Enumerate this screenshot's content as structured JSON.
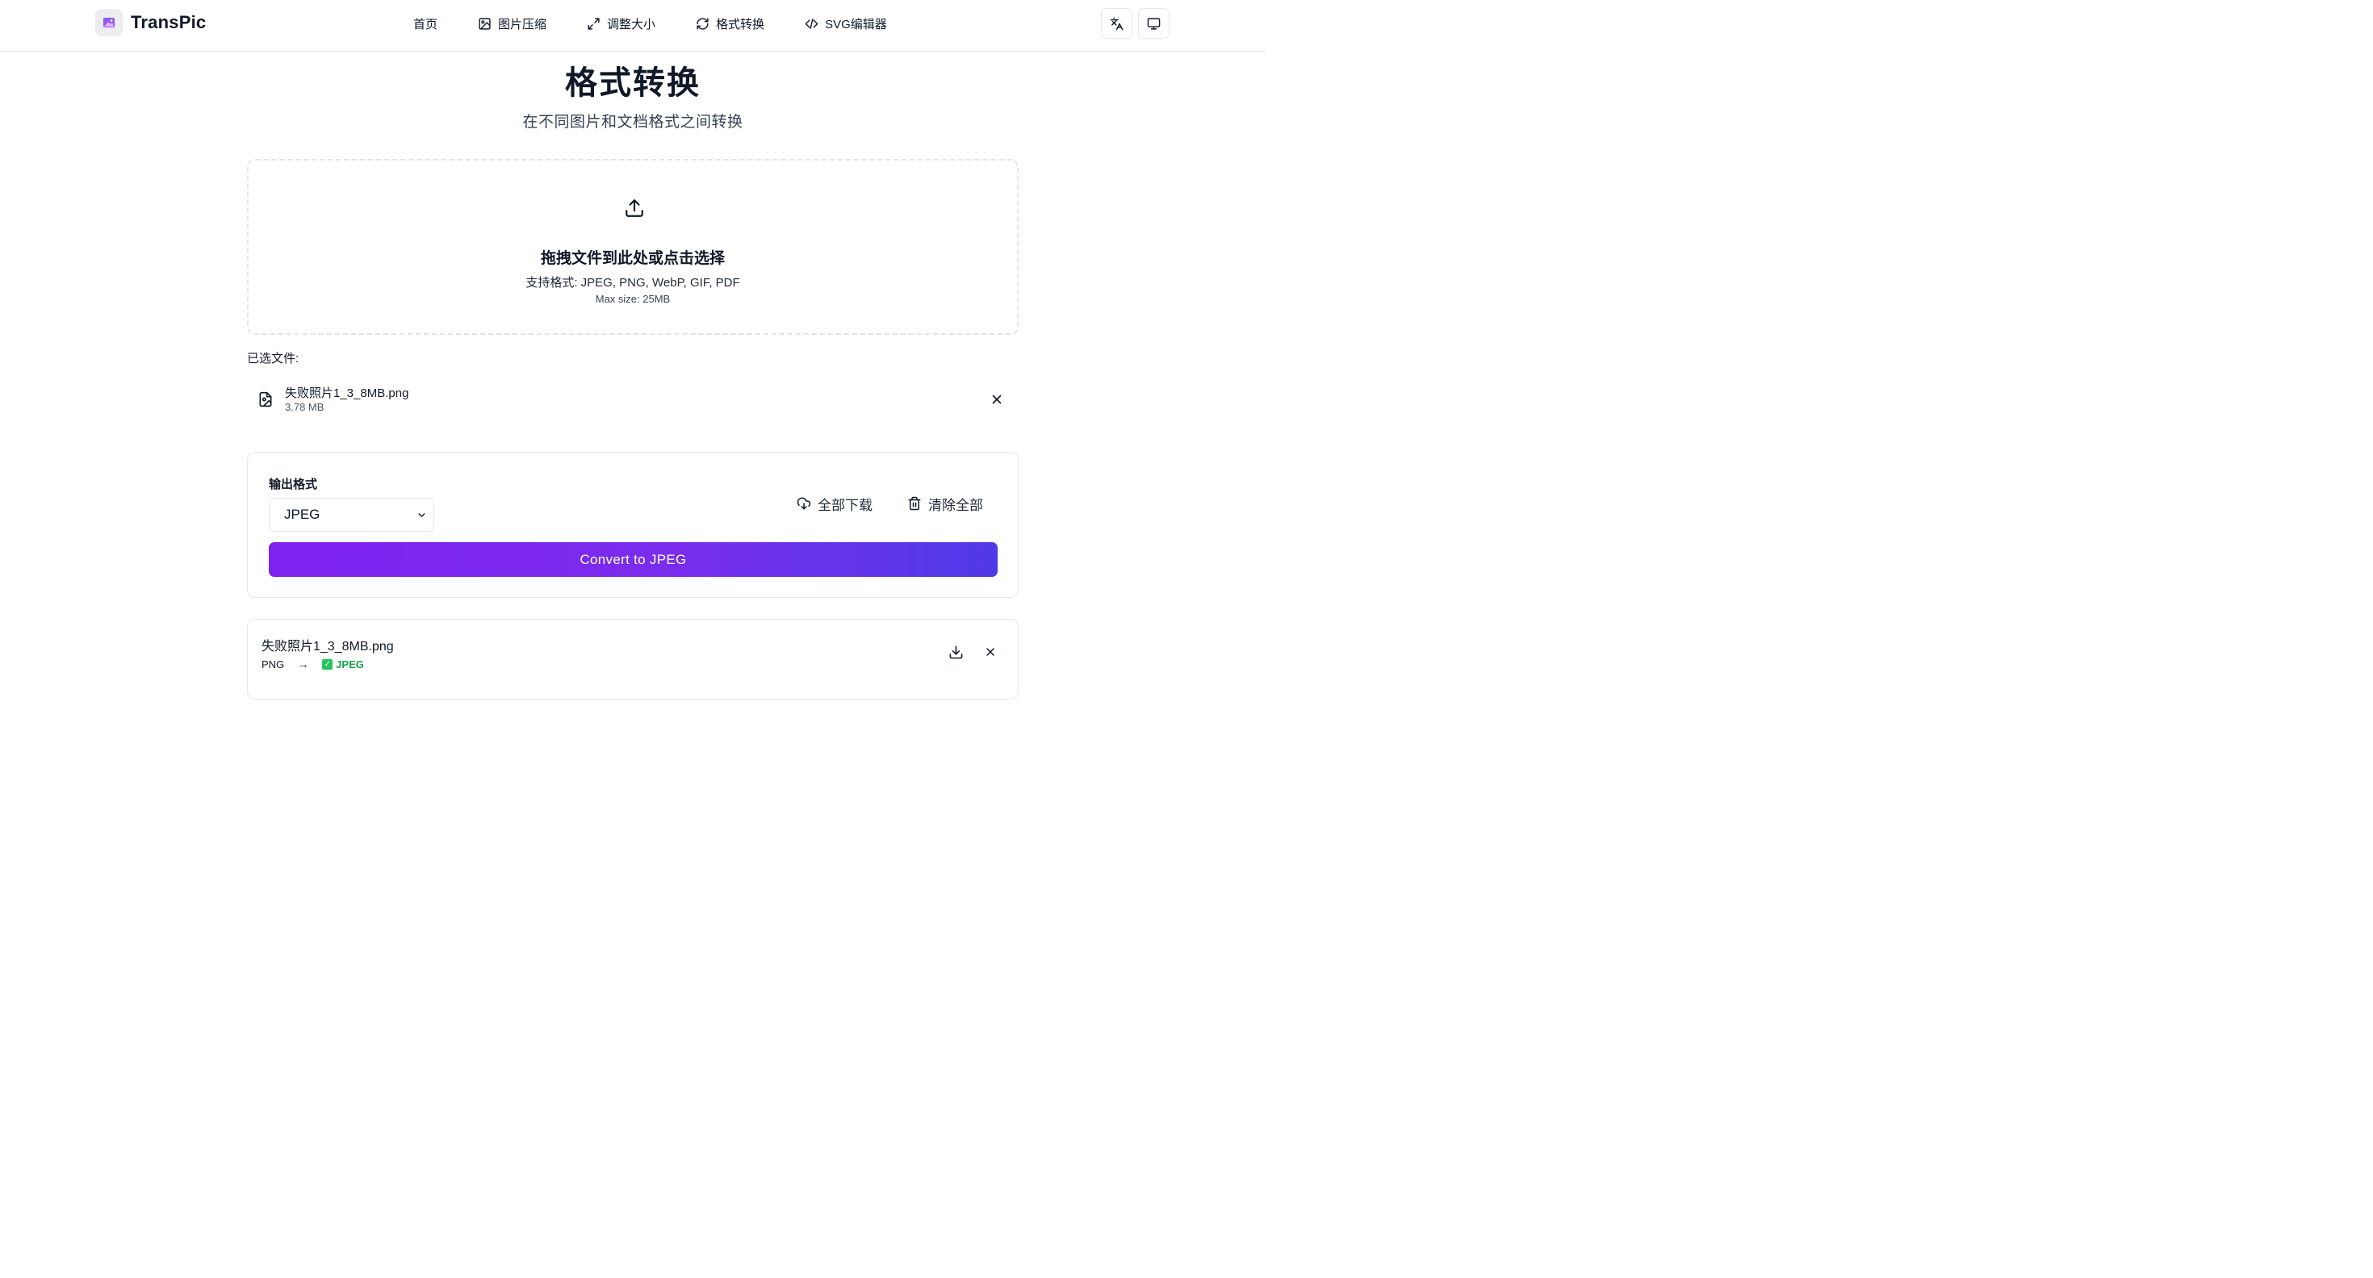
{
  "header": {
    "brand": "TransPic",
    "nav": [
      {
        "label": "首页",
        "icon": "none"
      },
      {
        "label": "图片压缩",
        "icon": "image-icon"
      },
      {
        "label": "调整大小",
        "icon": "resize-icon"
      },
      {
        "label": "格式转换",
        "icon": "refresh-icon"
      },
      {
        "label": "SVG编辑器",
        "icon": "code-icon"
      }
    ],
    "language_icon": "translate-icon",
    "theme_icon": "monitor-icon"
  },
  "hero": {
    "title": "格式转换",
    "subtitle": "在不同图片和文档格式之间转换"
  },
  "dropzone": {
    "main_text": "拖拽文件到此处或点击选择",
    "formats_text": "支持格式: JPEG, PNG, WebP, GIF, PDF",
    "size_text": "Max size: 25MB"
  },
  "selected": {
    "label": "已选文件:",
    "files": [
      {
        "name": "失败照片1_3_8MB.png",
        "size": "3.78 MB"
      }
    ]
  },
  "settings": {
    "output_label": "输出格式",
    "selected_format": "JPEG",
    "download_all": "全部下载",
    "clear_all": "清除全部",
    "convert_label": "Convert to JPEG"
  },
  "results": [
    {
      "name": "失败照片1_3_8MB.png",
      "from": "PNG",
      "arrow": "→",
      "check": "✓",
      "to": "JPEG"
    }
  ],
  "colors": {
    "accent_start": "#7e22f0",
    "accent_end": "#4f3ae8",
    "success": "#16a34a"
  }
}
